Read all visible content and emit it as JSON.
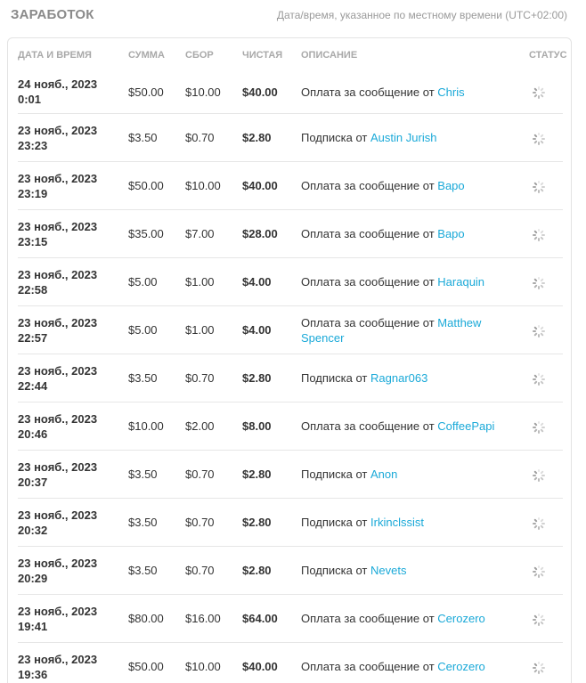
{
  "header": {
    "title": "Заработок",
    "timezone_note": "Дата/время, указанное по местному времени (UTC+02:00)"
  },
  "columns": {
    "date": "Дата и время",
    "amount": "Сумма",
    "fee": "Сбор",
    "net": "Чистая",
    "description": "Описание",
    "status": "Статус"
  },
  "rows": [
    {
      "date": "24 нояб., 2023",
      "time": "0:01",
      "amount": "$50.00",
      "fee": "$10.00",
      "net": "$40.00",
      "desc_prefix": "Оплата за сообщение от",
      "user": "Chris"
    },
    {
      "date": "23 нояб., 2023",
      "time": "23:23",
      "amount": "$3.50",
      "fee": "$0.70",
      "net": "$2.80",
      "desc_prefix": "Подписка от",
      "user": "Austin Jurish"
    },
    {
      "date": "23 нояб., 2023",
      "time": "23:19",
      "amount": "$50.00",
      "fee": "$10.00",
      "net": "$40.00",
      "desc_prefix": "Оплата за сообщение от",
      "user": "Bapo"
    },
    {
      "date": "23 нояб., 2023",
      "time": "23:15",
      "amount": "$35.00",
      "fee": "$7.00",
      "net": "$28.00",
      "desc_prefix": "Оплата за сообщение от",
      "user": "Bapo"
    },
    {
      "date": "23 нояб., 2023",
      "time": "22:58",
      "amount": "$5.00",
      "fee": "$1.00",
      "net": "$4.00",
      "desc_prefix": "Оплата за сообщение от",
      "user": "Haraquin"
    },
    {
      "date": "23 нояб., 2023",
      "time": "22:57",
      "amount": "$5.00",
      "fee": "$1.00",
      "net": "$4.00",
      "desc_prefix": "Оплата за сообщение от",
      "user": "Matthew Spencer"
    },
    {
      "date": "23 нояб., 2023",
      "time": "22:44",
      "amount": "$3.50",
      "fee": "$0.70",
      "net": "$2.80",
      "desc_prefix": "Подписка от",
      "user": "Ragnar063"
    },
    {
      "date": "23 нояб., 2023",
      "time": "20:46",
      "amount": "$10.00",
      "fee": "$2.00",
      "net": "$8.00",
      "desc_prefix": "Оплата за сообщение от",
      "user": "CoffeePapi"
    },
    {
      "date": "23 нояб., 2023",
      "time": "20:37",
      "amount": "$3.50",
      "fee": "$0.70",
      "net": "$2.80",
      "desc_prefix": "Подписка от",
      "user": "Anon"
    },
    {
      "date": "23 нояб., 2023",
      "time": "20:32",
      "amount": "$3.50",
      "fee": "$0.70",
      "net": "$2.80",
      "desc_prefix": "Подписка от",
      "user": "Irkinclssist"
    },
    {
      "date": "23 нояб., 2023",
      "time": "20:29",
      "amount": "$3.50",
      "fee": "$0.70",
      "net": "$2.80",
      "desc_prefix": "Подписка от",
      "user": "Nevets"
    },
    {
      "date": "23 нояб., 2023",
      "time": "19:41",
      "amount": "$80.00",
      "fee": "$16.00",
      "net": "$64.00",
      "desc_prefix": "Оплата за сообщение от",
      "user": "Cerozero"
    },
    {
      "date": "23 нояб., 2023",
      "time": "19:36",
      "amount": "$50.00",
      "fee": "$10.00",
      "net": "$40.00",
      "desc_prefix": "Оплата за сообщение от",
      "user": "Cerozero"
    }
  ],
  "status_icon": "loading-spinner-icon",
  "colors": {
    "link": "#1aa9d8",
    "title": "#8a8a8a",
    "header_text": "#a9a9a9",
    "divider": "#e6e6e6"
  }
}
